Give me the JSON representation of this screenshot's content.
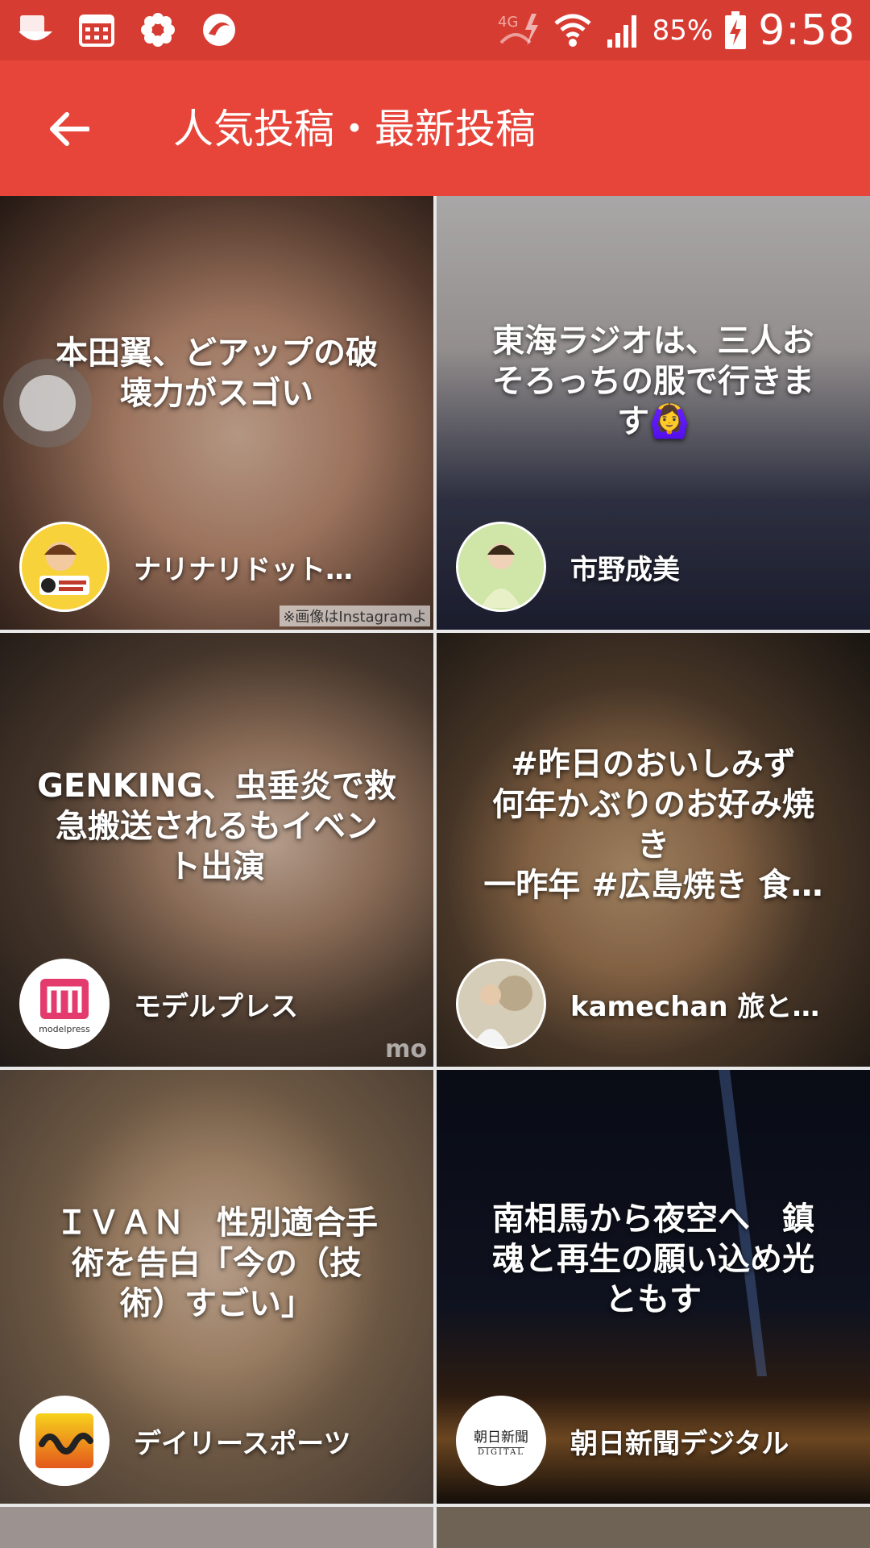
{
  "status_bar": {
    "battery": "85%",
    "time": "9:58",
    "network": "4G"
  },
  "header": {
    "title": "人気投稿・最新投稿"
  },
  "cards": [
    {
      "caption": "本田翼、どアップの破\n壊力がスゴい",
      "author": "ナリナリドット…",
      "watermark": "※画像はInstagramよ"
    },
    {
      "caption": "東海ラジオは、三人お\nそろっちの服で行きま\nす🙆‍♀",
      "author": "市野成美"
    },
    {
      "caption": "GENKING、虫垂炎で救\n急搬送されるもイベン\nト出演",
      "author": "モデルプレス",
      "avatar_text": "modelpress",
      "watermark": "mo"
    },
    {
      "caption": "#昨日のおいしみず\n何年かぶりのお好み焼\nき\n一昨年 #広島焼き 食…",
      "author": "kamechan 旅と…"
    },
    {
      "caption": "ＩＶＡＮ　性別適合手\n術を告白「今の（技\n術）すごい」",
      "author": "デイリースポーツ"
    },
    {
      "caption": "南相馬から夜空へ　鎮\n魂と再生の願い込め光\nともす",
      "author": "朝日新聞デジタル",
      "avatar_text": "朝日新聞",
      "avatar_sub": "DIGITAL"
    }
  ],
  "colors": {
    "status_bar": "#d73c32",
    "app_bar": "#e7453a"
  }
}
